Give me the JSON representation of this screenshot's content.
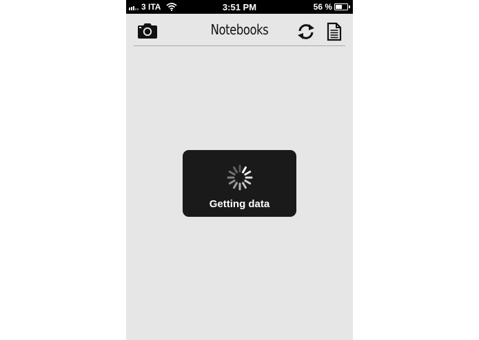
{
  "status_bar": {
    "carrier": "3 ITA",
    "time": "3:51 PM",
    "battery": "56 %",
    "battery_level": 0.56,
    "signal_bars": 5,
    "signal_bars_filled": 3
  },
  "nav": {
    "title": "Notebooks",
    "left_icon": "camera-icon",
    "right_icons": [
      "sync-icon",
      "document-icon"
    ]
  },
  "loading": {
    "message": "Getting data",
    "icon": "activity-spinner-icon"
  },
  "colors": {
    "background": "#e6e6e6",
    "status_bar": "#000000",
    "hud": "#1a1a1a",
    "divider": "#a8a8a8"
  }
}
